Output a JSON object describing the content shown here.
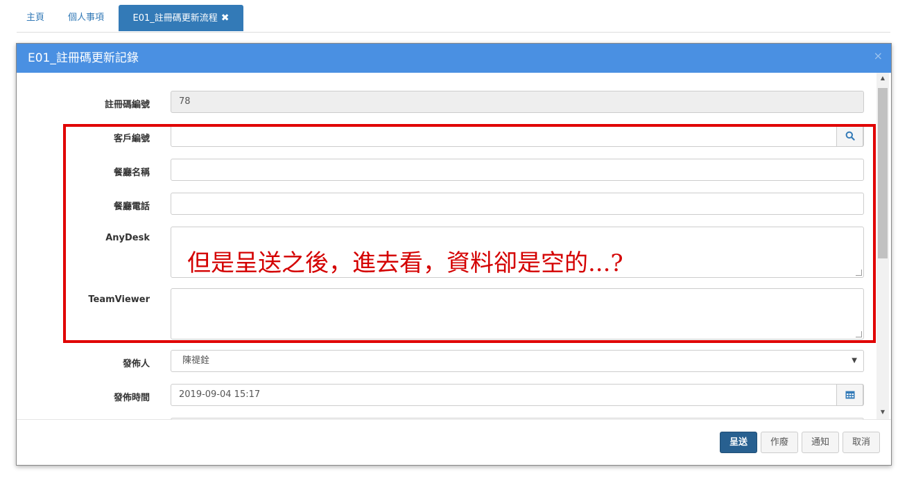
{
  "tabs": [
    {
      "label": "主頁"
    },
    {
      "label": "個人事項"
    },
    {
      "label": "E01_註冊碼更新流程",
      "close": "✖"
    }
  ],
  "modal": {
    "title": "E01_註冊碼更新記錄",
    "close": "×"
  },
  "form": {
    "reg_no": {
      "label": "註冊碼編號",
      "value": "78"
    },
    "customer_no": {
      "label": "客戶編號",
      "value": ""
    },
    "restaurant_name": {
      "label": "餐廳名稱",
      "value": ""
    },
    "restaurant_phone": {
      "label": "餐廳電話",
      "value": ""
    },
    "anydesk": {
      "label": "AnyDesk",
      "value": ""
    },
    "teamviewer": {
      "label": "TeamViewer",
      "value": ""
    },
    "publisher": {
      "label": "發佈人",
      "value": "陳禔銓"
    },
    "publish_time": {
      "label": "發佈時間",
      "value": "2019-09-04 15:17"
    }
  },
  "annotation": {
    "text": "但是呈送之後，進去看，資料卻是空的...?",
    "color": "#e00000"
  },
  "footer": {
    "submit": "呈送",
    "void": "作廢",
    "notify": "通知",
    "cancel": "取消"
  },
  "colors": {
    "header": "#4a90e2",
    "active_tab": "#337ab7",
    "primary_button": "#286090"
  },
  "icons": {
    "search": "search-icon",
    "calendar": "calendar-icon"
  }
}
